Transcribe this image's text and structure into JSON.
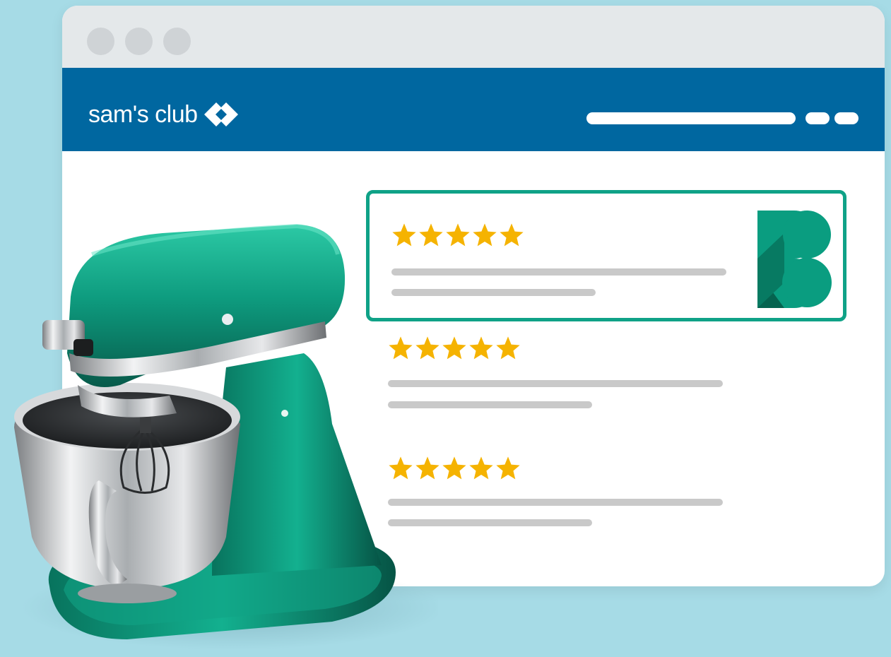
{
  "browser": {
    "window_dots": [
      "dot-1",
      "dot-2",
      "dot-3"
    ]
  },
  "header": {
    "brand_name": "sam's club",
    "brand_color": "#0067a0",
    "logo_icon": "chevron-diamond-icon"
  },
  "reviews": [
    {
      "rating": 5,
      "max_rating": 5,
      "featured": true,
      "badge_icon": "b-logo-icon"
    },
    {
      "rating": 5,
      "max_rating": 5,
      "featured": false
    },
    {
      "rating": 5,
      "max_rating": 5,
      "featured": false
    }
  ],
  "colors": {
    "background": "#a6dbe6",
    "star": "#f5b301",
    "accent": "#0fa287",
    "placeholder_line": "#c9c9c9"
  },
  "product_image": "stand-mixer-image"
}
